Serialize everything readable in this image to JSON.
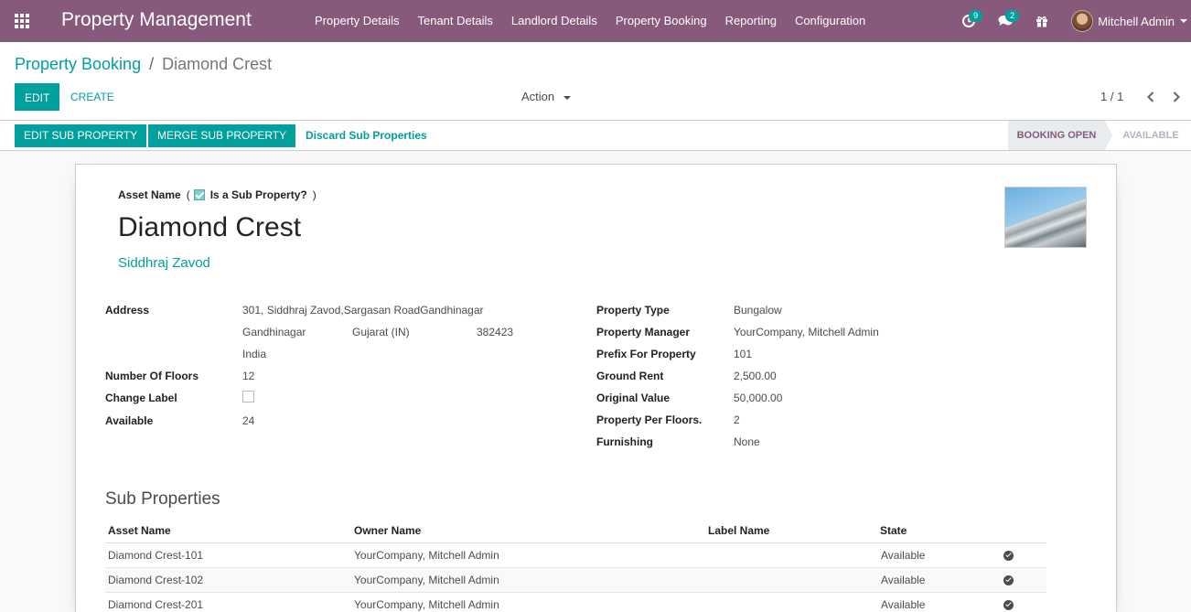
{
  "navbar": {
    "brand": "Property Management",
    "menu": [
      "Property Details",
      "Tenant Details",
      "Landlord Details",
      "Property Booking",
      "Reporting",
      "Configuration"
    ],
    "activity_count": "9",
    "messages_count": "2",
    "user_name": "Mitchell Admin",
    "color": "#875a7b"
  },
  "breadcrumb": {
    "parent": "Property Booking",
    "separator": "/",
    "current": "Diamond Crest"
  },
  "control": {
    "edit_label": "EDIT",
    "create_label": "CREATE",
    "action_label": "Action",
    "pager": "1 / 1"
  },
  "statusbar": {
    "edit_sub_label": "EDIT SUB PROPERTY",
    "merge_sub_label": "MERGE SUB PROPERTY",
    "discard_label": "Discard Sub Properties",
    "stages": [
      "BOOKING OPEN",
      "AVAILABLE"
    ],
    "active_stage": "BOOKING OPEN"
  },
  "record": {
    "asset_name_label": "Asset Name",
    "is_sub_label": "Is a Sub Property?",
    "is_sub_checked": true,
    "name": "Diamond Crest",
    "owner": "Siddhraj Zavod"
  },
  "left_fields": {
    "address_label": "Address",
    "street": "301, Siddhraj Zavod,Sargasan RoadGandhinagar",
    "city": "Gandhinagar",
    "state": "Gujarat (IN)",
    "zip": "382423",
    "country": "India",
    "floors_label": "Number Of Floors",
    "floors": "12",
    "change_label_label": "Change Label",
    "change_label_checked": false,
    "available_label": "Available",
    "available": "24"
  },
  "right_fields": [
    {
      "label": "Property Type",
      "value": "Bungalow"
    },
    {
      "label": "Property Manager",
      "value": "YourCompany, Mitchell Admin"
    },
    {
      "label": "Prefix For Property",
      "value": "101"
    },
    {
      "label": "Ground Rent",
      "value": "2,500.00"
    },
    {
      "label": "Original Value",
      "value": "50,000.00"
    },
    {
      "label": "Property Per Floors.",
      "value": "2"
    },
    {
      "label": "Furnishing",
      "value": "None"
    }
  ],
  "sub_properties": {
    "title": "Sub Properties",
    "columns": [
      "Asset Name",
      "Owner Name",
      "Label Name",
      "State"
    ],
    "rows": [
      {
        "asset": "Diamond Crest-101",
        "owner": "YourCompany, Mitchell Admin",
        "label": "",
        "state": "Available"
      },
      {
        "asset": "Diamond Crest-102",
        "owner": "YourCompany, Mitchell Admin",
        "label": "",
        "state": "Available"
      },
      {
        "asset": "Diamond Crest-201",
        "owner": "YourCompany, Mitchell Admin",
        "label": "",
        "state": "Available"
      }
    ]
  }
}
